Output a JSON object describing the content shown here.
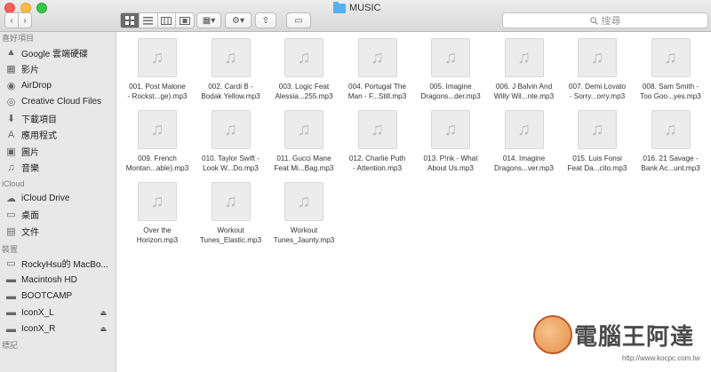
{
  "window": {
    "title": "MUSIC"
  },
  "toolbar": {
    "back_icon": "‹",
    "fwd_icon": "›",
    "arrange_icon": "▦▾",
    "action_icon": "⚙▾",
    "share_icon": "⇧",
    "tag_icon": "▭",
    "search_placeholder": "搜尋"
  },
  "sidebar": {
    "sections": {
      "favorites": "喜好項目",
      "icloud": "iCloud",
      "devices": "裝置",
      "tags": "標記"
    },
    "favorites": [
      {
        "label": "Google 雲端硬碟",
        "icon": "▲"
      },
      {
        "label": "影片",
        "icon": "▦"
      },
      {
        "label": "AirDrop",
        "icon": "◉"
      },
      {
        "label": "Creative Cloud Files",
        "icon": "◎"
      },
      {
        "label": "下載項目",
        "icon": "⬇"
      },
      {
        "label": "應用程式",
        "icon": "A"
      },
      {
        "label": "圖片",
        "icon": "▣"
      },
      {
        "label": "音樂",
        "icon": "♫"
      }
    ],
    "icloud": [
      {
        "label": "iCloud Drive",
        "icon": "☁"
      },
      {
        "label": "桌面",
        "icon": "▭"
      },
      {
        "label": "文件",
        "icon": "▤"
      }
    ],
    "devices": [
      {
        "label": "RockyHsu的 MacBo...",
        "icon": "▭"
      },
      {
        "label": "Macintosh HD",
        "icon": "▬"
      },
      {
        "label": "BOOTCAMP",
        "icon": "▬"
      },
      {
        "label": "IconX_L",
        "icon": "▬",
        "eject": "⏏"
      },
      {
        "label": "IconX_R",
        "icon": "▬",
        "eject": "⏏"
      }
    ]
  },
  "files": [
    {
      "name": "001. Post Malone\n- Rockst...ge).mp3"
    },
    {
      "name": "002. Cardi B -\nBodak Yellow.mp3"
    },
    {
      "name": "003. Logic Feat\nAlessia...255.mp3"
    },
    {
      "name": "004. Portugal The\nMan - F...Still.mp3"
    },
    {
      "name": "005. Imagine\nDragons...der.mp3"
    },
    {
      "name": "006. J Balvin And\nWilly Wil...nte.mp3"
    },
    {
      "name": "007. Demi Lovato\n- Sorry...orry.mp3"
    },
    {
      "name": "008. Sam Smith -\nToo Goo...yes.mp3"
    },
    {
      "name": "009. French\nMontan...able).mp3"
    },
    {
      "name": "010. Taylor Swift -\nLook W...Do.mp3"
    },
    {
      "name": "011. Gucci Mane\nFeat Mi...Bag.mp3"
    },
    {
      "name": "012. Charlie Puth\n- Attention.mp3"
    },
    {
      "name": "013. P!nk - What\nAbout Us.mp3"
    },
    {
      "name": "014. Imagine\nDragons...ver.mp3"
    },
    {
      "name": "015. Luis Fonsi\nFeat Da...cito.mp3"
    },
    {
      "name": "016. 21 Savage -\nBank Ac...unt.mp3"
    },
    {
      "name": "Over the\nHorizon.mp3"
    },
    {
      "name": "Workout\nTunes_Elastic.mp3"
    },
    {
      "name": "Workout\nTunes_Jaunty.mp3"
    }
  ],
  "file_icon": "♫",
  "watermark": {
    "brand": "電腦王阿達",
    "url": "http://www.kocpc.com.tw"
  }
}
